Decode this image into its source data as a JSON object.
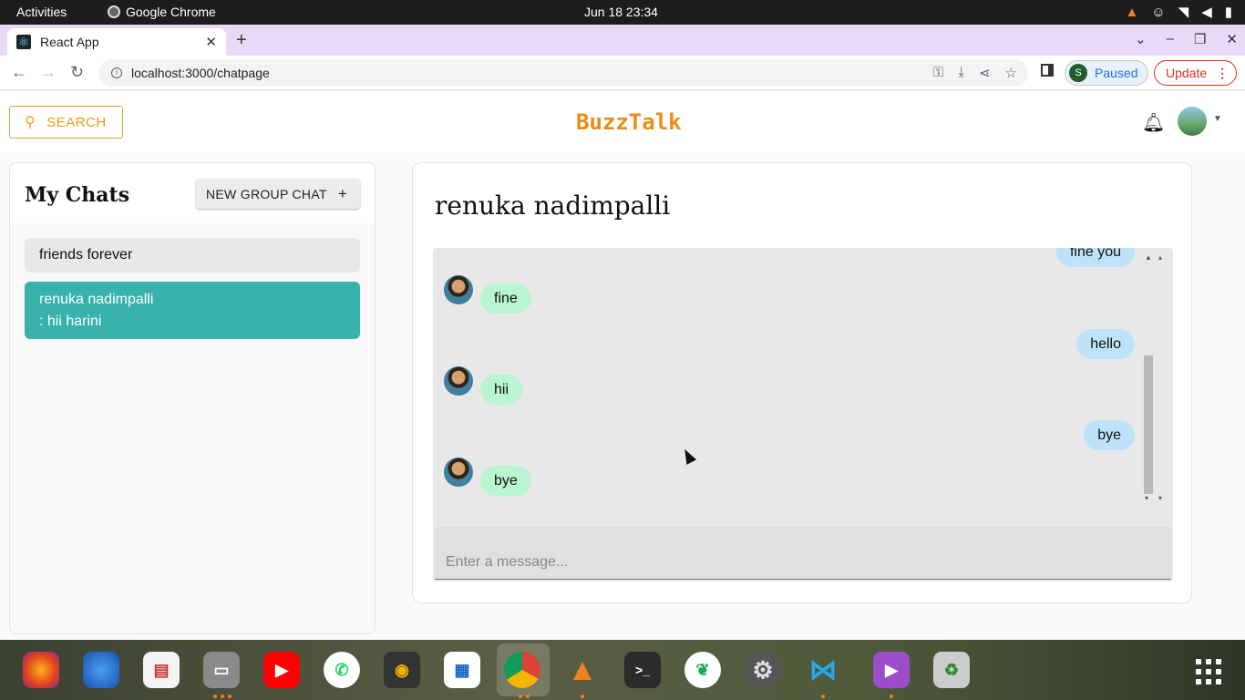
{
  "system": {
    "activities": "Activities",
    "app_name": "Google Chrome",
    "clock": "Jun 18  23:34"
  },
  "browser": {
    "tab_title": "React App",
    "url": "localhost:3000/chatpage",
    "profile_initial": "S",
    "paused_label": "Paused",
    "update_label": "Update"
  },
  "app": {
    "search_label": "SEARCH",
    "brand": "BuzzTalk",
    "accent_color": "#ed8c14"
  },
  "sidebar": {
    "title": "My Chats",
    "new_group_label": "NEW GROUP CHAT",
    "chats": [
      {
        "name": "friends forever",
        "latest": ""
      },
      {
        "name": "renuka nadimpalli",
        "latest": ": hii harini",
        "selected": true
      }
    ]
  },
  "chat": {
    "title": "renuka nadimpalli",
    "messages": [
      {
        "from": "me",
        "text": "fine you"
      },
      {
        "from": "them",
        "text": "fine"
      },
      {
        "from": "me",
        "text": "hello"
      },
      {
        "from": "them",
        "text": "hii"
      },
      {
        "from": "me",
        "text": "bye"
      },
      {
        "from": "them",
        "text": "bye"
      }
    ],
    "input_placeholder": "Enter a message...",
    "colors": {
      "sent": "#bee3f8",
      "received": "#b9f5d0",
      "selected_chat": "#38b2ac"
    }
  },
  "dock": {
    "apps": [
      "firefox-icon",
      "thunderbird-icon",
      "document-viewer-icon",
      "files-icon",
      "youtube-icon",
      "whatsapp-icon",
      "rhythmbox-icon",
      "libreoffice-writer-icon",
      "chrome-icon",
      "vlc-icon",
      "terminal-icon",
      "mongodb-compass-icon",
      "settings-icon",
      "vscode-icon",
      "video-player-icon",
      "trash-icon",
      "show-apps-icon"
    ]
  }
}
